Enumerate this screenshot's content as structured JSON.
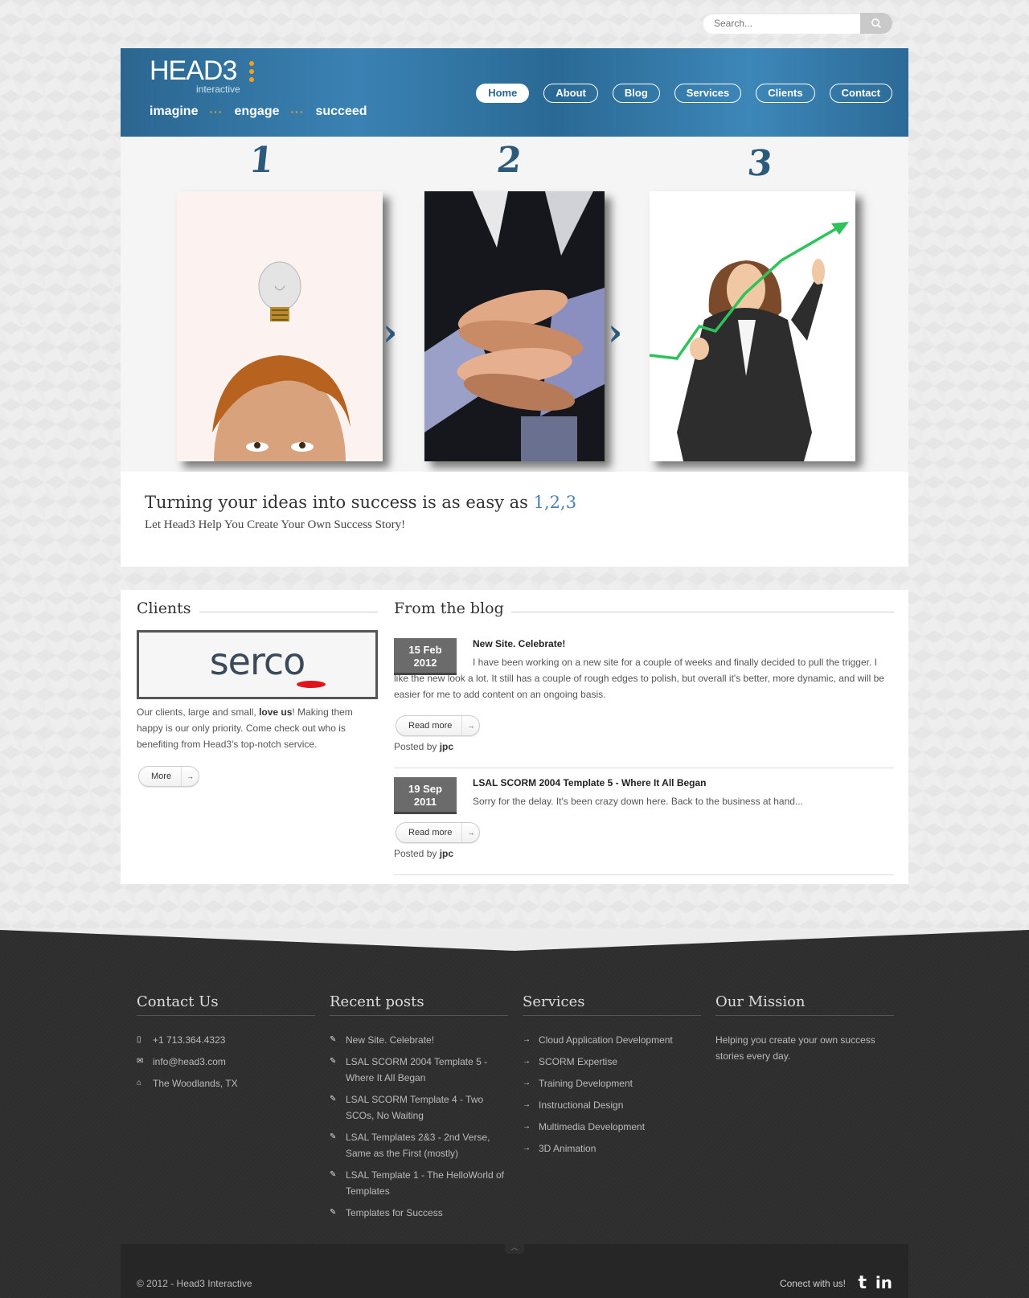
{
  "search": {
    "placeholder": "Search..."
  },
  "brand": {
    "logo": "HEAD3",
    "logo_sub": "interactive",
    "tag1": "imagine",
    "tag2": "engage",
    "tag3": "succeed",
    "sep": "···"
  },
  "nav": [
    {
      "label": "Home"
    },
    {
      "label": "About"
    },
    {
      "label": "Blog"
    },
    {
      "label": "Services"
    },
    {
      "label": "Clients"
    },
    {
      "label": "Contact"
    }
  ],
  "hero": {
    "num1": "1",
    "num2": "2",
    "num3": "3",
    "arrow": "›"
  },
  "intro": {
    "headline": "Turning your ideas into success is as easy as",
    "highlight": "1,2,3",
    "subline": "Let Head3 Help You Create Your Own Success Story!"
  },
  "clients": {
    "title": "Clients",
    "logo_text": "serco",
    "text_before": "Our clients, large and small, ",
    "text_bold": "love us",
    "text_after": "! Making them happy is our only priority. Come check out who is benefiting from Head3's top-notch service.",
    "more": "More"
  },
  "blog": {
    "title": "From the blog",
    "posts": [
      {
        "day_month": "15 Feb",
        "year": "2012",
        "title": "New Site. Celebrate!",
        "body": "I have been working on a new site for a couple of weeks and finally decided to pull the trigger.  I like the new look a lot. It still has a couple of rough edges to polish, but overall it's better, more dynamic, and will be easier for me to add content on an ongoing basis.",
        "read_more": "Read more",
        "posted_by": "Posted by",
        "author": "jpc"
      },
      {
        "day_month": "19 Sep",
        "year": "2011",
        "title": "LSAL SCORM 2004 Template 5 - Where It All Began",
        "body": "Sorry for the delay.  It's been crazy down here.  Back to the business at hand...",
        "read_more": "Read more",
        "posted_by": "Posted by",
        "author": "jpc"
      }
    ]
  },
  "footer": {
    "contact": {
      "title": "Contact Us",
      "phone": "+1 713.364.4323",
      "email": "info@head3.com",
      "location": "The Woodlands, TX"
    },
    "recent": {
      "title": "Recent posts",
      "items": [
        "New Site. Celebrate!",
        "LSAL SCORM 2004 Template 5 - Where It All Began",
        "LSAL SCORM Template 4 - Two SCOs, No Waiting",
        "LSAL Templates 2&3 - 2nd Verse, Same as the First (mostly)",
        "LSAL Template 1 - The HelloWorld of Templates",
        "Templates for Success"
      ]
    },
    "services": {
      "title": "Services",
      "items": [
        "Cloud Application Development",
        "SCORM Expertise",
        "Training Development",
        "Instructional Design",
        "Multimedia Development",
        "3D Animation"
      ]
    },
    "mission": {
      "title": "Our Mission",
      "text": "Helping you create your own success stories every day."
    },
    "copyright": "© 2012 - Head3 Interactive",
    "connect": "Conect with us!",
    "twitter_glyph": "t",
    "linkedin_glyph": "in"
  },
  "colors": {
    "header_blue": "#2b6690",
    "accent_orange": "#f4a01e",
    "link_blue": "#4a80b8",
    "footer_bg": "#2e2e2e"
  }
}
